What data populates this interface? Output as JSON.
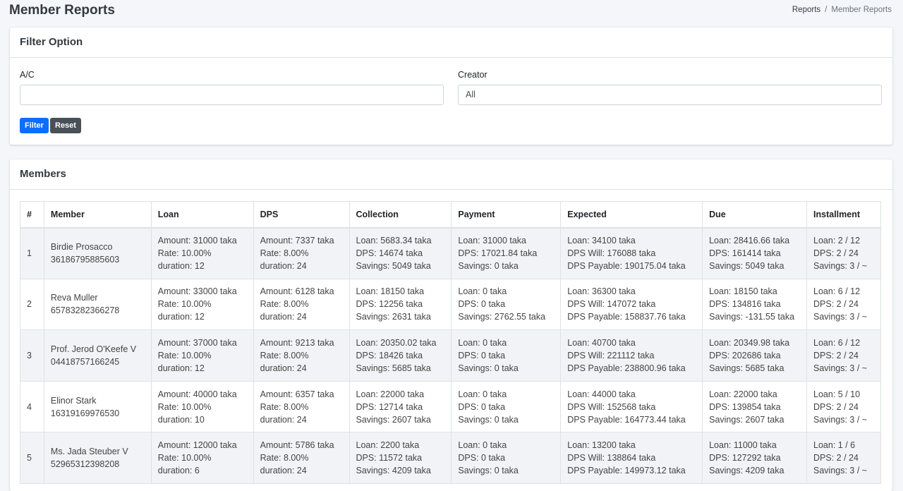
{
  "header": {
    "title": "Member Reports",
    "breadcrumb": {
      "parent": "Reports",
      "separator": "/",
      "current": "Member Reports"
    }
  },
  "filter": {
    "title": "Filter Option",
    "ac_label": "A/C",
    "ac_value": "",
    "creator_label": "Creator",
    "creator_value": "All",
    "filter_button": "Filter",
    "reset_button": "Reset"
  },
  "members": {
    "title": "Members",
    "columns": [
      "#",
      "Member",
      "Loan",
      "DPS",
      "Collection",
      "Payment",
      "Expected",
      "Due",
      "Installment"
    ],
    "rows": [
      {
        "num": "1",
        "name": "Birdie Prosacco",
        "account": "36186795885603",
        "loan": [
          "Amount: 31000 taka",
          "Rate: 10.00%",
          "duration: 12"
        ],
        "dps": [
          "Amount: 7337 taka",
          "Rate: 8.00%",
          "duration: 24"
        ],
        "collection": [
          "Loan: 5683.34 taka",
          "DPS: 14674 taka",
          "Savings: 5049 taka"
        ],
        "payment": [
          "Loan: 31000 taka",
          "DPS: 17021.84 taka",
          "Savings: 0 taka"
        ],
        "expected": [
          "Loan: 34100 taka",
          "DPS Will: 176088 taka",
          "DPS Payable: 190175.04 taka"
        ],
        "due": [
          "Loan: 28416.66 taka",
          "DPS: 161414 taka",
          "Savings: 5049 taka"
        ],
        "installment": [
          "Loan: 2 / 12",
          "DPS: 2 / 24",
          "Savings: 3 / ~"
        ]
      },
      {
        "num": "2",
        "name": "Reva Muller",
        "account": "65783282366278",
        "loan": [
          "Amount: 33000 taka",
          "Rate: 10.00%",
          "duration: 12"
        ],
        "dps": [
          "Amount: 6128 taka",
          "Rate: 8.00%",
          "duration: 24"
        ],
        "collection": [
          "Loan: 18150 taka",
          "DPS: 12256 taka",
          "Savings: 2631 taka"
        ],
        "payment": [
          "Loan: 0 taka",
          "DPS: 0 taka",
          "Savings: 2762.55 taka"
        ],
        "expected": [
          "Loan: 36300 taka",
          "DPS Will: 147072 taka",
          "DPS Payable: 158837.76 taka"
        ],
        "due": [
          "Loan: 18150 taka",
          "DPS: 134816 taka",
          "Savings: -131.55 taka"
        ],
        "installment": [
          "Loan: 6 / 12",
          "DPS: 2 / 24",
          "Savings: 3 / ~"
        ]
      },
      {
        "num": "3",
        "name": "Prof. Jerod O'Keefe V",
        "account": "04418757166245",
        "loan": [
          "Amount: 37000 taka",
          "Rate: 10.00%",
          "duration: 12"
        ],
        "dps": [
          "Amount: 9213 taka",
          "Rate: 8.00%",
          "duration: 24"
        ],
        "collection": [
          "Loan: 20350.02 taka",
          "DPS: 18426 taka",
          "Savings: 5685 taka"
        ],
        "payment": [
          "Loan: 0 taka",
          "DPS: 0 taka",
          "Savings: 0 taka"
        ],
        "expected": [
          "Loan: 40700 taka",
          "DPS Will: 221112 taka",
          "DPS Payable: 238800.96 taka"
        ],
        "due": [
          "Loan: 20349.98 taka",
          "DPS: 202686 taka",
          "Savings: 5685 taka"
        ],
        "installment": [
          "Loan: 6 / 12",
          "DPS: 2 / 24",
          "Savings: 3 / ~"
        ]
      },
      {
        "num": "4",
        "name": "Elinor Stark",
        "account": "16319169976530",
        "loan": [
          "Amount: 40000 taka",
          "Rate: 10.00%",
          "duration: 10"
        ],
        "dps": [
          "Amount: 6357 taka",
          "Rate: 8.00%",
          "duration: 24"
        ],
        "collection": [
          "Loan: 22000 taka",
          "DPS: 12714 taka",
          "Savings: 2607 taka"
        ],
        "payment": [
          "Loan: 0 taka",
          "DPS: 0 taka",
          "Savings: 0 taka"
        ],
        "expected": [
          "Loan: 44000 taka",
          "DPS Will: 152568 taka",
          "DPS Payable: 164773.44 taka"
        ],
        "due": [
          "Loan: 22000 taka",
          "DPS: 139854 taka",
          "Savings: 2607 taka"
        ],
        "installment": [
          "Loan: 5 / 10",
          "DPS: 2 / 24",
          "Savings: 3 / ~"
        ]
      },
      {
        "num": "5",
        "name": "Ms. Jada Steuber V",
        "account": "52965312398208",
        "loan": [
          "Amount: 12000 taka",
          "Rate: 10.00%",
          "duration: 6"
        ],
        "dps": [
          "Amount: 5786 taka",
          "Rate: 8.00%",
          "duration: 24"
        ],
        "collection": [
          "Loan: 2200 taka",
          "DPS: 11572 taka",
          "Savings: 4209 taka"
        ],
        "payment": [
          "Loan: 0 taka",
          "DPS: 0 taka",
          "Savings: 0 taka"
        ],
        "expected": [
          "Loan: 13200 taka",
          "DPS Will: 138864 taka",
          "DPS Payable: 149973.12 taka"
        ],
        "due": [
          "Loan: 11000 taka",
          "DPS: 127292 taka",
          "Savings: 4209 taka"
        ],
        "installment": [
          "Loan: 1 / 6",
          "DPS: 2 / 24",
          "Savings: 3 / ~"
        ]
      }
    ]
  }
}
